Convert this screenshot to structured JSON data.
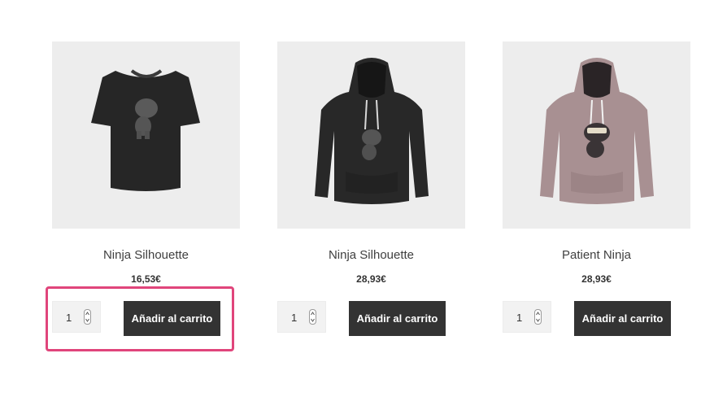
{
  "colors": {
    "button_bg": "#333333",
    "button_text": "#ffffff",
    "thumb_bg": "#ededed",
    "highlight": "#e0457b"
  },
  "products": [
    {
      "title": "Ninja Silhouette",
      "price": "16,53€",
      "quantity": "1",
      "button_label": "Añadir al carrito",
      "garment": "black t-shirt"
    },
    {
      "title": "Ninja Silhouette",
      "price": "28,93€",
      "quantity": "1",
      "button_label": "Añadir al carrito",
      "garment": "black hoodie"
    },
    {
      "title": "Patient Ninja",
      "price": "28,93€",
      "quantity": "1",
      "button_label": "Añadir al carrito",
      "garment": "mauve hoodie"
    }
  ]
}
